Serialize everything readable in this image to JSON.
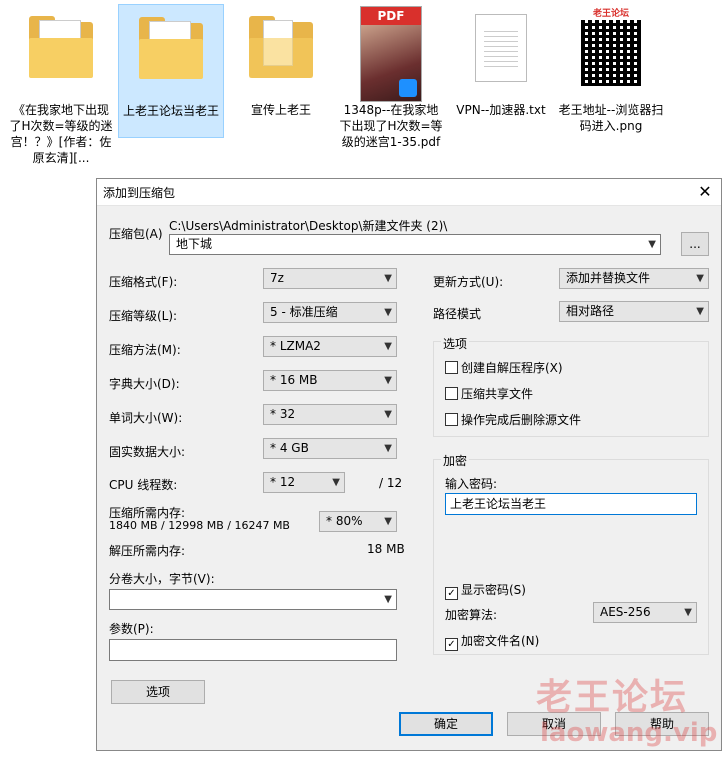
{
  "desktop_files": [
    {
      "label": "《在我家地下出现了H次数=等级的迷宫！？》[作者：佐原玄清][..."
    },
    {
      "label": "上老王论坛当老王"
    },
    {
      "label": "宣传上老王"
    },
    {
      "label": "1348p--在我家地下出现了H次数=等级的迷宫1-35.pdf",
      "badge": "PDF"
    },
    {
      "label": "VPN--加速器.txt"
    },
    {
      "label": "老王地址--浏览器扫码进入.png",
      "header": "老王论坛"
    }
  ],
  "dialog": {
    "title": "添加到压缩包",
    "close_glyph": "✕",
    "archive_label": "压缩包(A)",
    "archive_path": "C:\\Users\\Administrator\\Desktop\\新建文件夹 (2)\\",
    "archive_name": "地下城",
    "browse_label": "...",
    "left": {
      "format_label": "压缩格式(F):",
      "format_value": "7z",
      "level_label": "压缩等级(L):",
      "level_value": "5 - 标准压缩",
      "method_label": "压缩方法(M):",
      "method_value": "*  LZMA2",
      "dict_label": "字典大小(D):",
      "dict_value": "*  16 MB",
      "word_label": "单词大小(W):",
      "word_value": "*  32",
      "solid_label": "固实数据大小:",
      "solid_value": "*  4 GB",
      "cpu_label": "CPU 线程数:",
      "cpu_value": "*  12",
      "cpu_total": "/ 12",
      "mem_label": "压缩所需内存:",
      "mem_detail": "1840 MB / 12998 MB / 16247 MB",
      "mem_value": "*  80%",
      "decomp_label": "解压所需内存:",
      "decomp_value": "18 MB",
      "split_label": "分卷大小，字节(V):",
      "split_value": "",
      "params_label": "参数(P):",
      "params_value": "",
      "options_button": "选项"
    },
    "right": {
      "update_label": "更新方式(U):",
      "update_value": "添加并替换文件",
      "path_label": "路径模式",
      "path_value": "相对路径",
      "options_group": "选项",
      "opt_sfx": "创建自解压程序(X)",
      "opt_sfx_checked": false,
      "opt_shared": "压缩共享文件",
      "opt_shared_checked": false,
      "opt_delete": "操作完成后删除源文件",
      "opt_delete_checked": false,
      "encrypt_group": "加密",
      "password_label": "输入密码:",
      "password_value": "上老王论坛当老王",
      "show_password": "显示密码(S)",
      "show_password_checked": true,
      "algo_label": "加密算法:",
      "algo_value": "AES-256",
      "encrypt_names": "加密文件名(N)",
      "encrypt_names_checked": true
    },
    "buttons": {
      "ok": "确定",
      "cancel": "取消",
      "help": "帮助"
    }
  },
  "watermark": {
    "title": "老王论坛",
    "url": "laowang.vip"
  }
}
